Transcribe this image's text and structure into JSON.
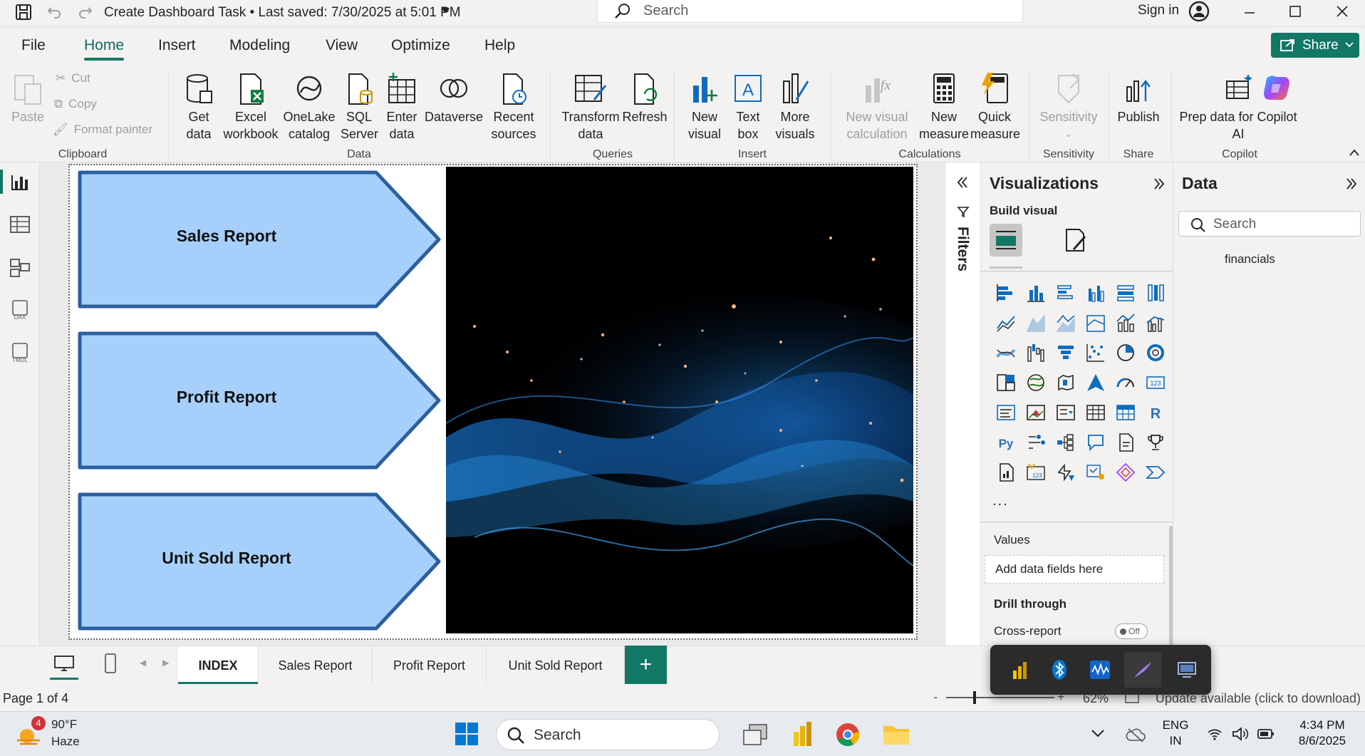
{
  "window": {
    "title": "Create Dashboard Task • Last saved: 7/30/2025 at 5:01 PM",
    "search_placeholder": "Search",
    "sign_in": "Sign in"
  },
  "menu": {
    "tabs": [
      "File",
      "Home",
      "Insert",
      "Modeling",
      "View",
      "Optimize",
      "Help"
    ],
    "active": "Home",
    "share": "Share"
  },
  "ribbon": {
    "clipboard": {
      "paste": "Paste",
      "cut": "Cut",
      "copy": "Copy",
      "format_painter": "Format painter",
      "group": "Clipboard"
    },
    "data": {
      "get_data": [
        "Get",
        "data"
      ],
      "excel": [
        "Excel",
        "workbook"
      ],
      "onelake": [
        "OneLake",
        "catalog"
      ],
      "sql": [
        "SQL",
        "Server"
      ],
      "enter": [
        "Enter",
        "data"
      ],
      "dataverse": "Dataverse",
      "recent": [
        "Recent",
        "sources"
      ],
      "group": "Data"
    },
    "queries": {
      "transform": [
        "Transform",
        "data"
      ],
      "refresh": "Refresh",
      "group": "Queries"
    },
    "insert": {
      "new_visual": [
        "New",
        "visual"
      ],
      "text_box": [
        "Text",
        "box"
      ],
      "more_visuals": [
        "More",
        "visuals"
      ],
      "group": "Insert"
    },
    "calculations": {
      "new_visual_calc": [
        "New visual",
        "calculation"
      ],
      "new_measure": [
        "New",
        "measure"
      ],
      "quick_measure": [
        "Quick",
        "measure"
      ],
      "group": "Calculations"
    },
    "sensitivity": {
      "label": "Sensitivity",
      "group": "Sensitivity"
    },
    "share": {
      "publish": "Publish",
      "group": "Share"
    },
    "copilot": {
      "prep": [
        "Prep data for Copilot",
        "AI"
      ],
      "group": "Copilot"
    }
  },
  "canvas": {
    "buttons": [
      "Sales Report",
      "Profit Report",
      "Unit Sold Report"
    ]
  },
  "filters": {
    "label": "Filters"
  },
  "visualizations": {
    "title": "Visualizations",
    "build_visual": "Build visual",
    "more": "...",
    "values": "Values",
    "add_fields": "Add data fields here",
    "drill_through": "Drill through",
    "cross_report": "Cross-report",
    "toggle": "Off"
  },
  "data_pane": {
    "title": "Data",
    "search_placeholder": "Search",
    "tables": [
      "financials"
    ]
  },
  "page_tabs": [
    "INDEX",
    "Sales Report",
    "Profit Report",
    "Unit Sold Report"
  ],
  "active_page": "INDEX",
  "status": {
    "page": "Page 1 of 4",
    "zoom": "62%",
    "update": "Update available (click to download)"
  },
  "taskbar": {
    "weather_temp": "90°F",
    "weather_desc": "Haze",
    "weather_badge": "4",
    "search": "Search",
    "lang": [
      "ENG",
      "IN"
    ],
    "time": "4:34 PM",
    "date": "8/6/2025"
  },
  "colors": {
    "accent": "#117865",
    "arrow_fill": "#a6d0fb"
  }
}
